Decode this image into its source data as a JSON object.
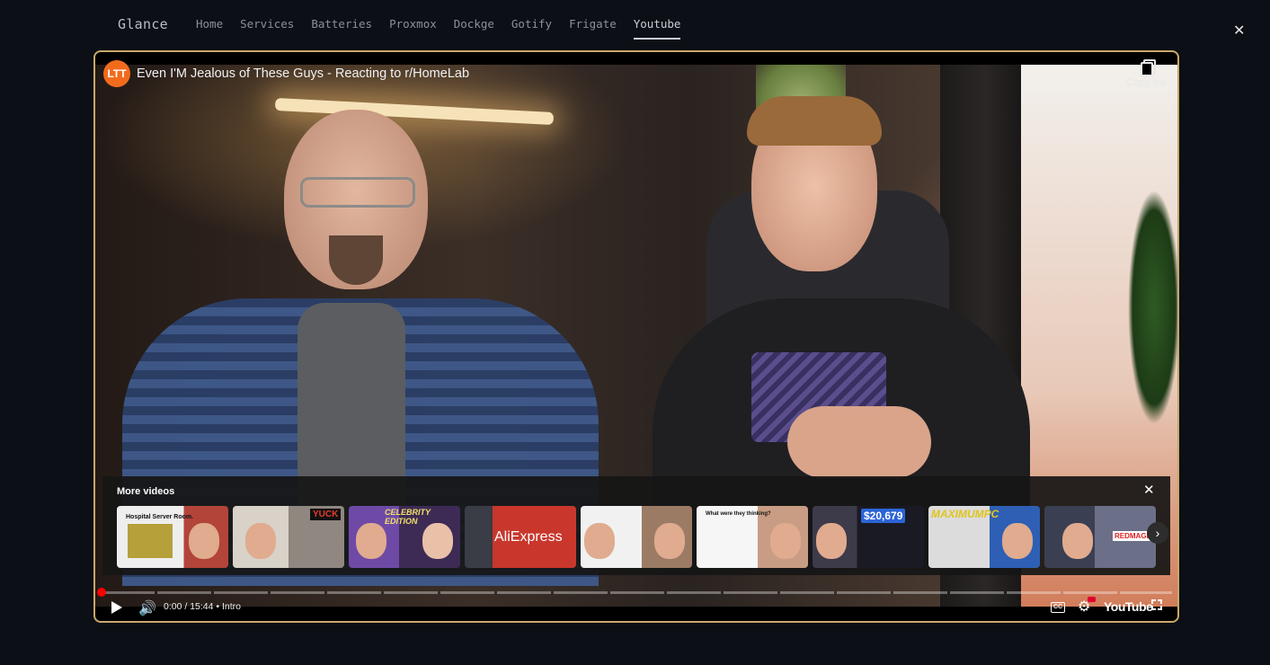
{
  "nav": {
    "brand": "Glance",
    "items": [
      {
        "label": "Home"
      },
      {
        "label": "Services"
      },
      {
        "label": "Batteries"
      },
      {
        "label": "Proxmox"
      },
      {
        "label": "Dockge"
      },
      {
        "label": "Gotify"
      },
      {
        "label": "Frigate"
      },
      {
        "label": "Youtube",
        "active": true
      }
    ],
    "close_icon": "close-icon"
  },
  "player": {
    "title": "Even I'M Jealous of These Guys - Reacting to r/HomeLab",
    "channel_avatar_text": "LTT",
    "copy_link_label": "Copy link",
    "more_videos": {
      "title": "More videos",
      "thumbnails": [
        {
          "caption": "Hospital Server Room."
        },
        {
          "caption": "YUCK"
        },
        {
          "caption": "CELEBRITY EDITION"
        },
        {
          "caption": "AliExpress"
        },
        {
          "caption": ""
        },
        {
          "caption": "What were they thinking?"
        },
        {
          "caption": "$20,679"
        },
        {
          "caption": "MAXIMUMPC"
        },
        {
          "caption": "REDMAGIC"
        }
      ]
    },
    "time": "0:00 / 15:44",
    "chapter": "• Intro",
    "cc_label": "CC",
    "youtube_label": "YouTube",
    "accent": "#ff0000",
    "border_color": "#c8a96a"
  }
}
